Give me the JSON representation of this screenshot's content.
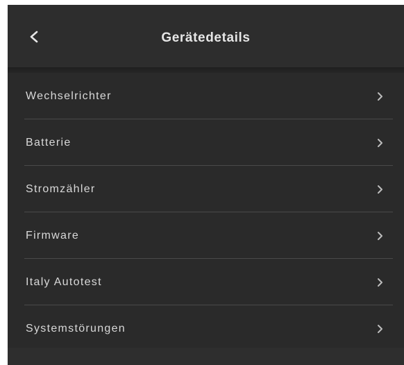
{
  "header": {
    "title": "Gerätedetails",
    "back_icon": "chevron-left-icon"
  },
  "menu": {
    "items": [
      {
        "label": "Wechselrichter",
        "icon": "chevron-right-icon"
      },
      {
        "label": "Batterie",
        "icon": "chevron-right-icon"
      },
      {
        "label": "Stromzähler",
        "icon": "chevron-right-icon"
      },
      {
        "label": "Firmware",
        "icon": "chevron-right-icon"
      },
      {
        "label": "Italy Autotest",
        "icon": "chevron-right-icon"
      },
      {
        "label": "Systemstörungen",
        "icon": "chevron-right-icon"
      }
    ]
  },
  "colors": {
    "background": "#2a2a2a",
    "text": "#d9d9d9",
    "title": "#e6e6e6",
    "divider": "#4a4a4a",
    "chevron": "#bdbdbd"
  }
}
